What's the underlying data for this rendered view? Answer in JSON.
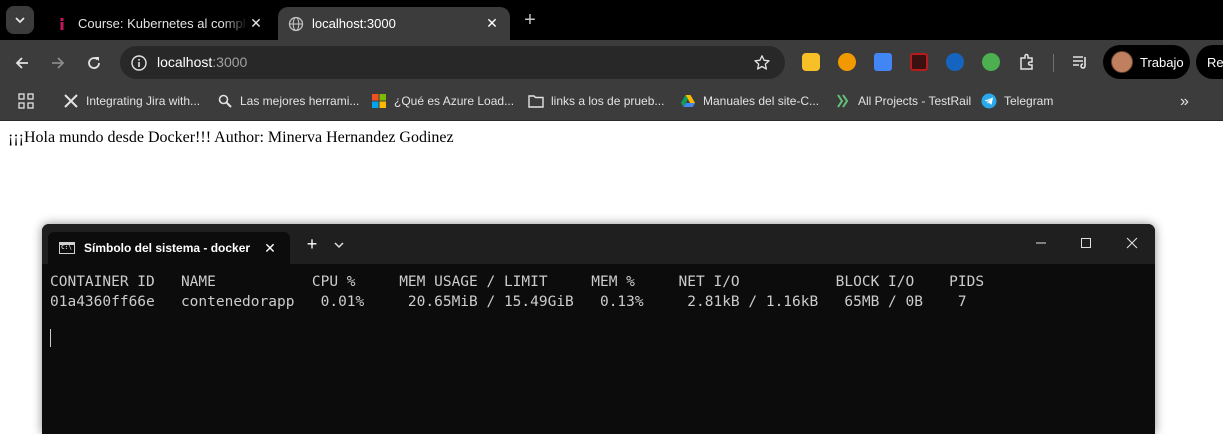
{
  "browser": {
    "tabs": [
      {
        "title": "Course: Kubernetes al completo",
        "active": false,
        "favicon": "course-favicon-icon",
        "favicon_color": "#c2185b"
      },
      {
        "title": "localhost:3000",
        "active": true,
        "favicon": "globe-icon"
      }
    ],
    "address": {
      "host": "localhost",
      "port": ":3000"
    },
    "profile": {
      "label": "Trabajo"
    },
    "profile2": {
      "label": "Rei"
    },
    "extensions": [
      {
        "name": "keep-extension-icon",
        "color": "#f6c026"
      },
      {
        "name": "ext-orange-icon",
        "color": "#f29900"
      },
      {
        "name": "google-translate-icon",
        "color": "#4285f4"
      },
      {
        "name": "pdf-extension-icon",
        "color": "#b71c1c"
      },
      {
        "name": "ext-blue-icon",
        "color": "#1565c0"
      },
      {
        "name": "ext-green-icon",
        "color": "#4caf50"
      },
      {
        "name": "extensions-puzzle-icon",
        "color": "#e3e3e3"
      },
      {
        "name": "media-controls-icon",
        "color": "#e3e3e3"
      }
    ]
  },
  "bookmarks": [
    {
      "label": "Integrating Jira with...",
      "icon": "x-logo-icon"
    },
    {
      "label": "Las mejores herrami...",
      "icon": "magnifier-icon"
    },
    {
      "label": "¿Qué es Azure Load...",
      "icon": "microsoft-logo-icon"
    },
    {
      "label": "links a los de prueb...",
      "icon": "folder-icon"
    },
    {
      "label": "Manuales del site-C...",
      "icon": "google-drive-icon"
    },
    {
      "label": "All Projects - TestRail",
      "icon": "testrail-icon"
    },
    {
      "label": "Telegram",
      "icon": "telegram-icon"
    }
  ],
  "page": {
    "text": "¡¡¡Hola mundo desde Docker!!! Author: Minerva Hernandez Godinez"
  },
  "terminal": {
    "tab_title": "Símbolo del sistema - docker",
    "header_line": "CONTAINER ID   NAME           CPU %     MEM USAGE / LIMIT     MEM %     NET I/O           BLOCK I/O    PIDS",
    "row_line": "01a4360ff66e   contenedorapp   0.01%     20.65MiB / 15.49GiB   0.13%     2.81kB / 1.16kB   65MB / 0B    7"
  }
}
